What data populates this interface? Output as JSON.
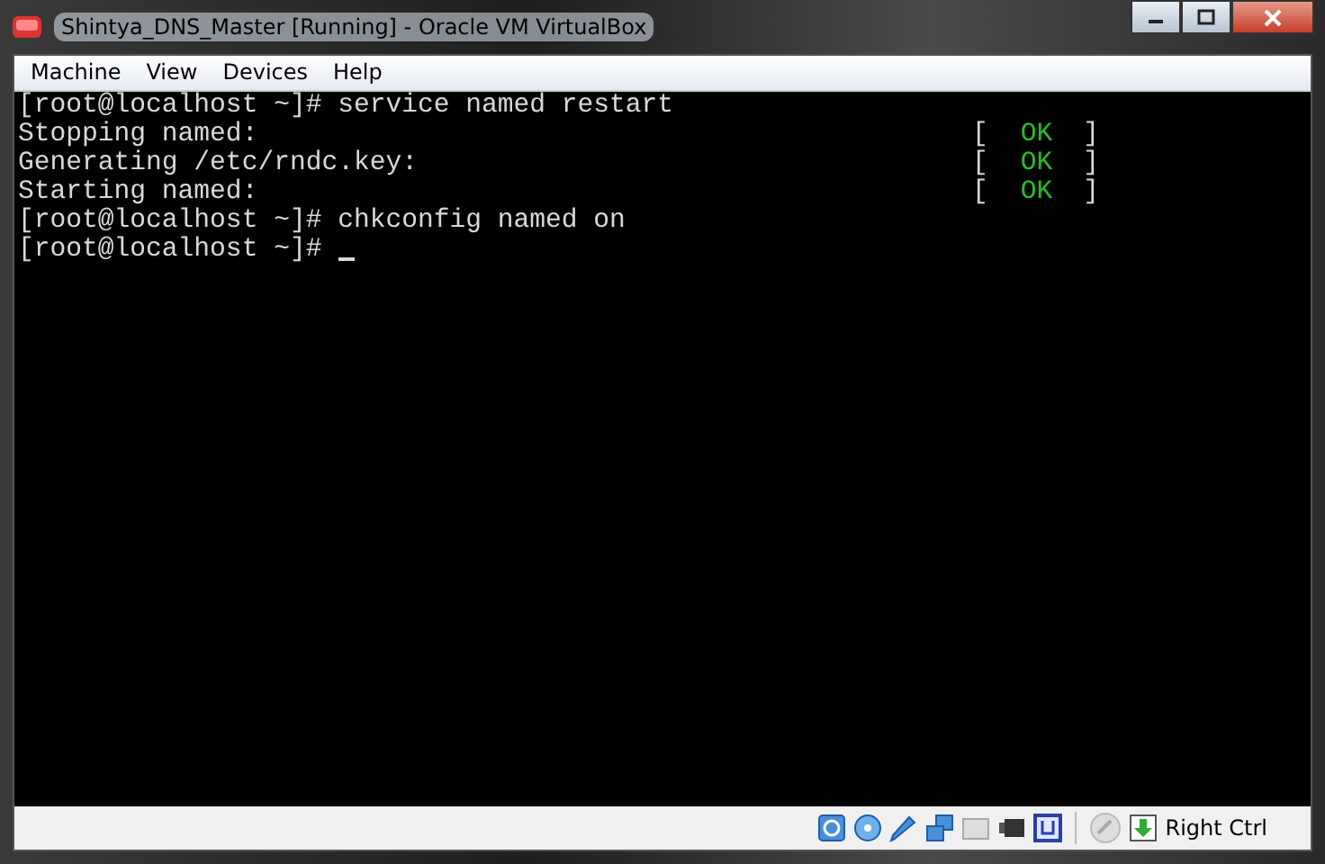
{
  "window": {
    "title": "Shintya_DNS_Master [Running] - Oracle VM VirtualBox"
  },
  "menu": [
    "Machine",
    "View",
    "Devices",
    "Help"
  ],
  "console": {
    "lines": [
      {
        "text": "[root@localhost ~]# service named restart",
        "cursor": false
      },
      {
        "text": "Stopping named:",
        "cursor": false,
        "status": {
          "left": "[",
          "text": "OK",
          "right": "]"
        }
      },
      {
        "text": "Generating /etc/rndc.key:",
        "cursor": false,
        "status": {
          "left": "[",
          "text": "OK",
          "right": "]"
        }
      },
      {
        "text": "Starting named:",
        "cursor": false,
        "status": {
          "left": "[",
          "text": "OK",
          "right": "]"
        }
      },
      {
        "text": "[root@localhost ~]# chkconfig named on",
        "cursor": false
      },
      {
        "text": "[root@localhost ~]#",
        "cursor": true
      }
    ]
  },
  "status_bar": {
    "host_key": "Right Ctrl"
  }
}
